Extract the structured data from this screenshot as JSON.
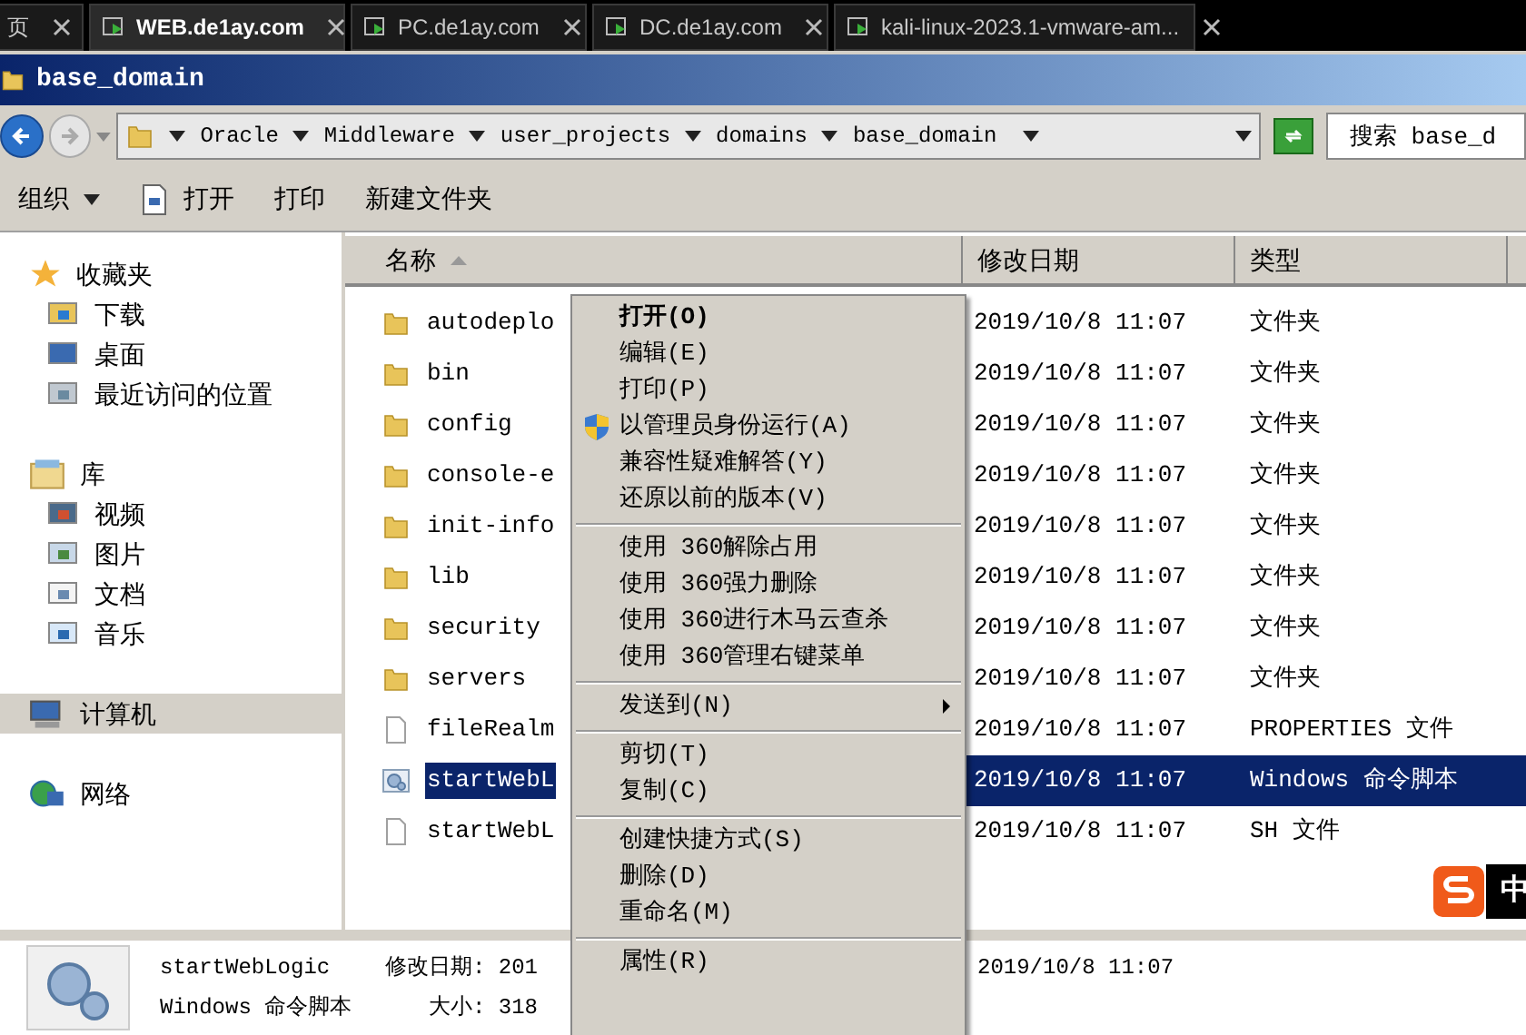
{
  "browser_tabs": [
    {
      "label": "页",
      "selected": false
    },
    {
      "label": "WEB.de1ay.com",
      "selected": true
    },
    {
      "label": "PC.de1ay.com",
      "selected": false
    },
    {
      "label": "DC.de1ay.com",
      "selected": false
    },
    {
      "label": "kali-linux-2023.1-vmware-am...",
      "selected": false
    }
  ],
  "window": {
    "title": "base_domain"
  },
  "address": {
    "breadcrumbs": [
      "Oracle",
      "Middleware",
      "user_projects",
      "domains",
      "base_domain"
    ],
    "search": {
      "placeholder": "搜索 base_d"
    }
  },
  "toolbar": [
    {
      "label": "组织",
      "kind": "dropdown"
    },
    {
      "label": "打开",
      "kind": "icon"
    },
    {
      "label": "打印",
      "kind": "plain"
    },
    {
      "label": "新建文件夹",
      "kind": "plain"
    }
  ],
  "sidebar": {
    "groups": [
      {
        "label": "收藏夹",
        "selected": false,
        "children": [
          {
            "label": "下载",
            "selected": false
          },
          {
            "label": "桌面",
            "selected": false
          },
          {
            "label": "最近访问的位置",
            "selected": false
          }
        ]
      },
      {
        "label": "库",
        "selected": false,
        "children": [
          {
            "label": "视频",
            "selected": false
          },
          {
            "label": "图片",
            "selected": false
          },
          {
            "label": "文档",
            "selected": false
          },
          {
            "label": "音乐",
            "selected": false
          }
        ]
      },
      {
        "label": "计算机",
        "selected": true
      },
      {
        "label": "网络",
        "selected": false
      }
    ]
  },
  "table": {
    "columns": [
      {
        "label": "名称",
        "sorted": true
      },
      {
        "label": "修改日期",
        "sorted": false
      },
      {
        "label": "类型",
        "sorted": false
      }
    ],
    "rows": [
      {
        "name": "autodeplo",
        "date": "2019/10/8 11:07",
        "type": "文件夹",
        "kind": "folder",
        "selected": false
      },
      {
        "name": "bin",
        "date": "2019/10/8 11:07",
        "type": "文件夹",
        "kind": "folder",
        "selected": false
      },
      {
        "name": "config",
        "date": "2019/10/8 11:07",
        "type": "文件夹",
        "kind": "folder",
        "selected": false
      },
      {
        "name": "console-e",
        "date": "2019/10/8 11:07",
        "type": "文件夹",
        "kind": "folder",
        "selected": false
      },
      {
        "name": "init-info",
        "date": "2019/10/8 11:07",
        "type": "文件夹",
        "kind": "folder",
        "selected": false
      },
      {
        "name": "lib",
        "date": "2019/10/8 11:07",
        "type": "文件夹",
        "kind": "folder",
        "selected": false
      },
      {
        "name": "security",
        "date": "2019/10/8 11:07",
        "type": "文件夹",
        "kind": "folder",
        "selected": false
      },
      {
        "name": "servers",
        "date": "2019/10/8 11:07",
        "type": "文件夹",
        "kind": "folder",
        "selected": false
      },
      {
        "name": "fileRealm",
        "date": "2019/10/8 11:07",
        "type": "PROPERTIES 文件",
        "kind": "file",
        "selected": false
      },
      {
        "name": "startWebL",
        "date": "2019/10/8 11:07",
        "type": "Windows 命令脚本",
        "kind": "script",
        "selected": true
      },
      {
        "name": "startWebL",
        "date": "2019/10/8 11:07",
        "type": "SH 文件",
        "kind": "file",
        "selected": false
      }
    ]
  },
  "context_menu": [
    {
      "kind": "item",
      "label": "打开(O)",
      "default": true,
      "shield": false,
      "submenu": false
    },
    {
      "kind": "item",
      "label": "编辑(E)",
      "default": false,
      "shield": false,
      "submenu": false
    },
    {
      "kind": "item",
      "label": "打印(P)",
      "default": false,
      "shield": false,
      "submenu": false
    },
    {
      "kind": "item",
      "label": "以管理员身份运行(A)",
      "default": false,
      "shield": true,
      "submenu": false
    },
    {
      "kind": "item",
      "label": "兼容性疑难解答(Y)",
      "default": false,
      "shield": false,
      "submenu": false
    },
    {
      "kind": "item",
      "label": "还原以前的版本(V)",
      "default": false,
      "shield": false,
      "submenu": false
    },
    {
      "kind": "separator"
    },
    {
      "kind": "item",
      "label": "使用 360解除占用",
      "default": false,
      "shield": false,
      "submenu": false
    },
    {
      "kind": "item",
      "label": "使用 360强力删除",
      "default": false,
      "shield": false,
      "submenu": false
    },
    {
      "kind": "item",
      "label": "使用 360进行木马云查杀",
      "default": false,
      "shield": false,
      "submenu": false
    },
    {
      "kind": "item",
      "label": "使用 360管理右键菜单",
      "default": false,
      "shield": false,
      "submenu": false
    },
    {
      "kind": "separator"
    },
    {
      "kind": "item",
      "label": "发送到(N)",
      "default": false,
      "shield": false,
      "submenu": true
    },
    {
      "kind": "separator"
    },
    {
      "kind": "item",
      "label": "剪切(T)",
      "default": false,
      "shield": false,
      "submenu": false
    },
    {
      "kind": "item",
      "label": "复制(C)",
      "default": false,
      "shield": false,
      "submenu": false
    },
    {
      "kind": "separator"
    },
    {
      "kind": "item",
      "label": "创建快捷方式(S)",
      "default": false,
      "shield": false,
      "submenu": false
    },
    {
      "kind": "item",
      "label": "删除(D)",
      "default": false,
      "shield": false,
      "submenu": false
    },
    {
      "kind": "item",
      "label": "重命名(M)",
      "default": false,
      "shield": false,
      "submenu": false
    },
    {
      "kind": "separator"
    },
    {
      "kind": "item",
      "label": "属性(R)",
      "default": false,
      "shield": false,
      "submenu": false
    }
  ],
  "details": {
    "name": "startWebLogic",
    "modified_label": "修改日期: 201",
    "modified_value": "2019/10/8 11:07",
    "type": "Windows 命令脚本",
    "size_label": "大小: 318"
  },
  "ime": {
    "mode": "中"
  }
}
